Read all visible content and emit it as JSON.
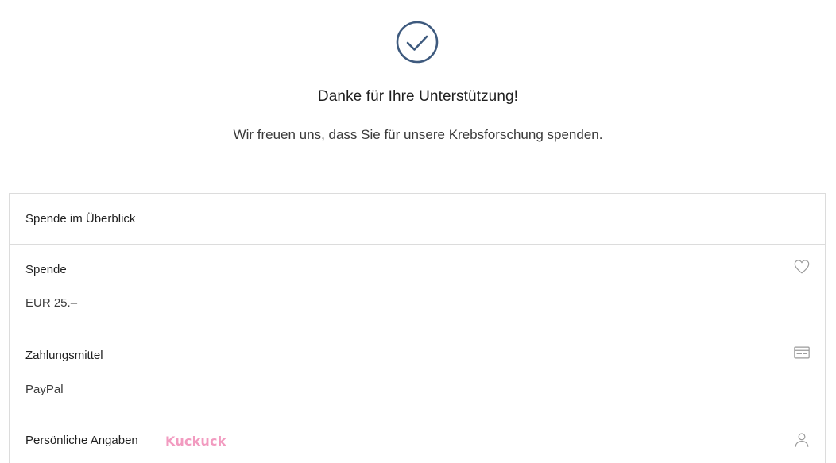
{
  "confirmation": {
    "title": "Danke für Ihre Unterstützung!",
    "subtitle": "Wir freuen uns, dass Sie für unsere Krebsforschung spenden.",
    "check_icon": "check-circle-icon",
    "accent_color": "#3e5a7e"
  },
  "summary": {
    "header": "Spende im Überblick",
    "sections": [
      {
        "label": "Spende",
        "value": "EUR 25.–",
        "icon": "heart-icon"
      },
      {
        "label": "Zahlungsmittel",
        "value": "PayPal",
        "icon": "credit-card-icon"
      },
      {
        "label": "Persönliche Angaben",
        "value": "",
        "icon": "user-icon"
      }
    ]
  },
  "watermark": {
    "text": "Kuckuck",
    "color": "#f29bc0"
  }
}
